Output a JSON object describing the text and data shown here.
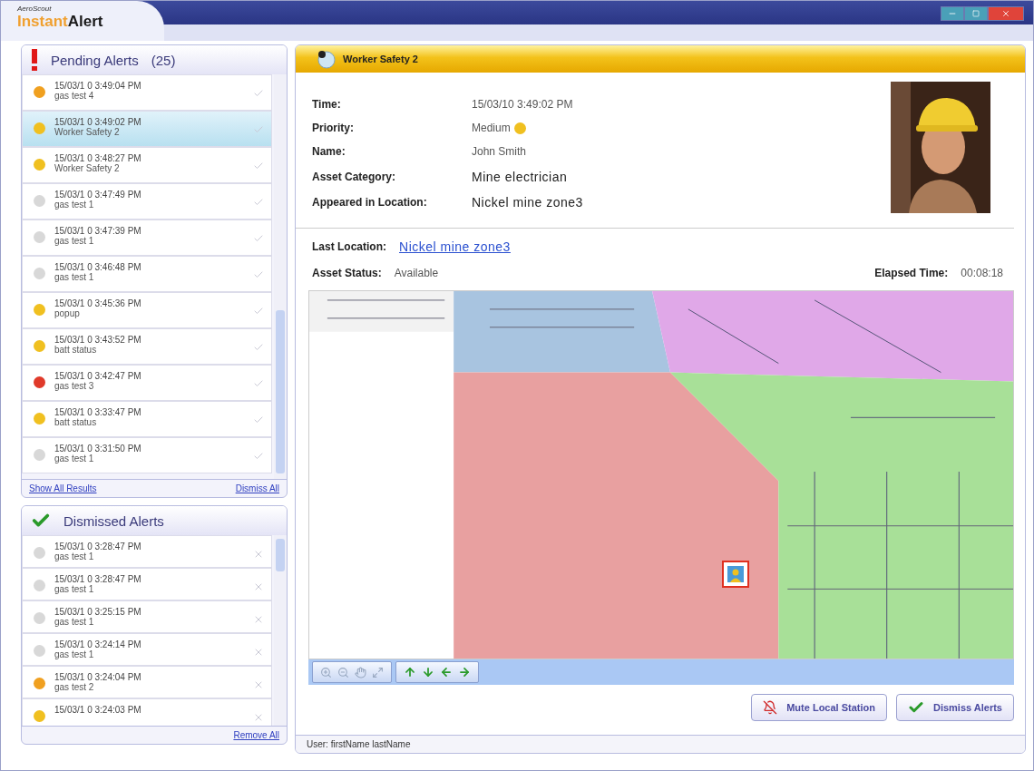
{
  "app": {
    "logo_small": "AeroScout",
    "logo_light": "Instant",
    "logo_bold": "Alert"
  },
  "pending": {
    "title": "Pending Alerts",
    "count": "(25)",
    "rows": [
      {
        "time": "15/03/1 0 3:49:04 PM",
        "name": "gas test 4",
        "color": "#f0a020",
        "selected": false
      },
      {
        "time": "15/03/1 0 3:49:02 PM",
        "name": "Worker Safety 2",
        "color": "#f0c020",
        "selected": true
      },
      {
        "time": "15/03/1 0 3:48:27 PM",
        "name": "Worker Safety 2",
        "color": "#f0c020",
        "selected": false
      },
      {
        "time": "15/03/1 0 3:47:49 PM",
        "name": "gas test 1",
        "color": "#d8d8d8",
        "selected": false
      },
      {
        "time": "15/03/1 0 3:47:39 PM",
        "name": "gas test 1",
        "color": "#d8d8d8",
        "selected": false
      },
      {
        "time": "15/03/1 0 3:46:48 PM",
        "name": "gas test 1",
        "color": "#d8d8d8",
        "selected": false
      },
      {
        "time": "15/03/1 0 3:45:36 PM",
        "name": "popup",
        "color": "#f0c020",
        "selected": false
      },
      {
        "time": "15/03/1 0 3:43:52 PM",
        "name": "batt status",
        "color": "#f0c020",
        "selected": false
      },
      {
        "time": "15/03/1 0 3:42:47 PM",
        "name": "gas test 3",
        "color": "#e03a2a",
        "selected": false
      },
      {
        "time": "15/03/1 0 3:33:47 PM",
        "name": "batt status",
        "color": "#f0c020",
        "selected": false
      },
      {
        "time": "15/03/1 0 3:31:50 PM",
        "name": "gas test 1",
        "color": "#d8d8d8",
        "selected": false
      }
    ],
    "links": [
      "Show All Results",
      "Dismiss All"
    ]
  },
  "dismissed": {
    "title": "Dismissed Alerts",
    "rows": [
      {
        "time": "15/03/1 0 3:28:47 PM",
        "name": "gas test 1",
        "color": "#d8d8d8"
      },
      {
        "time": "15/03/1 0 3:28:47 PM",
        "name": "gas test 1",
        "color": "#d8d8d8"
      },
      {
        "time": "15/03/1 0 3:25:15 PM",
        "name": "gas test 1",
        "color": "#d8d8d8"
      },
      {
        "time": "15/03/1 0 3:24:14 PM",
        "name": "gas test 1",
        "color": "#d8d8d8"
      },
      {
        "time": "15/03/1 0 3:24:04 PM",
        "name": "gas test 2",
        "color": "#f0a020"
      },
      {
        "time": "15/03/1 0 3:24:03 PM",
        "name": "",
        "color": "#f0c020"
      }
    ],
    "link": "Remove All"
  },
  "detail": {
    "title": "Worker Safety 2",
    "fields": [
      {
        "label": "Time:",
        "value": "15/03/10 3:49:02 PM",
        "kind": "small"
      },
      {
        "label": "Priority:",
        "value": "Medium",
        "kind": "priority",
        "color": "#f0c020"
      },
      {
        "label": "Name:",
        "value": "John Smith",
        "kind": "small"
      },
      {
        "label": "Asset Category:",
        "value": "Mine electrician",
        "kind": "large"
      },
      {
        "label": "Appeared in Location:",
        "value": "Nickel mine zone3",
        "kind": "large"
      }
    ],
    "last_location_label": "Last Location:",
    "last_location": "Nickel mine zone3",
    "status_label": "Asset Status:",
    "status": "Available",
    "elapsed_label": "Elapsed Time:",
    "elapsed": "00:08:18",
    "buttons": [
      "Mute Local Station",
      "Dismiss Alerts"
    ]
  },
  "status_bar": "User: firstName lastName"
}
